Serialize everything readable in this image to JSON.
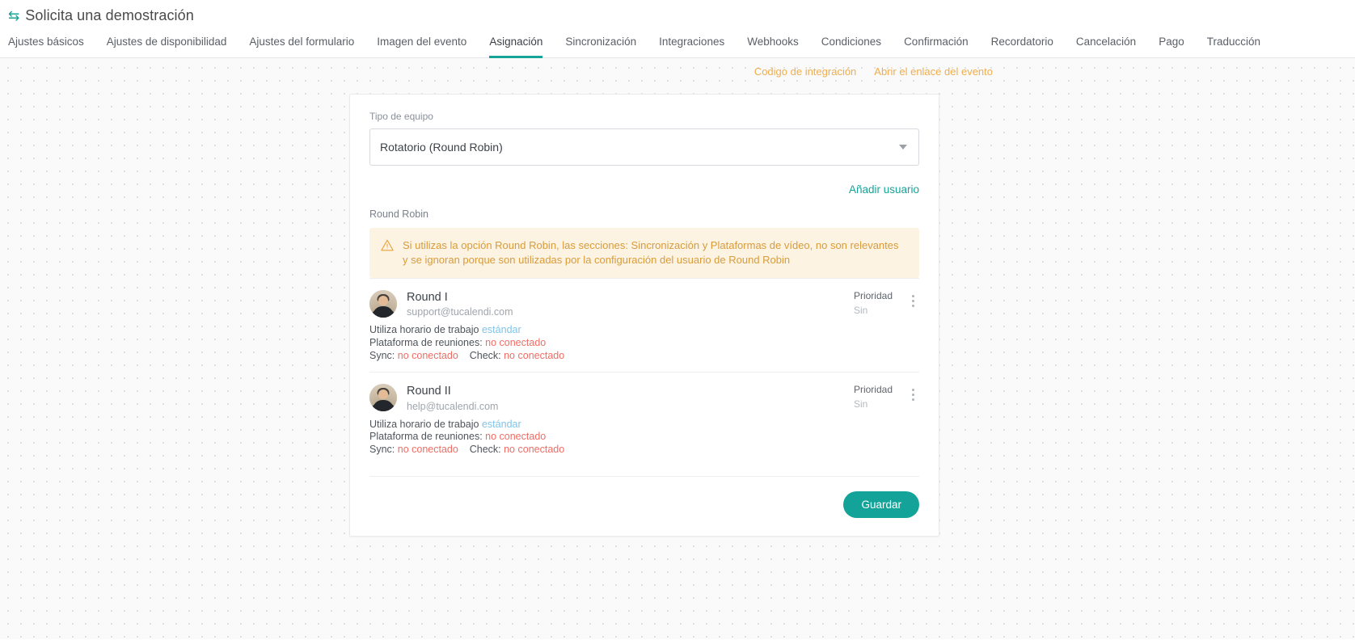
{
  "header": {
    "icon": "swap-arrows-icon",
    "title": "Solicita una demostración"
  },
  "tabs": [
    {
      "label": "Ajustes básicos",
      "active": false
    },
    {
      "label": "Ajustes de disponibilidad",
      "active": false
    },
    {
      "label": "Ajustes del formulario",
      "active": false
    },
    {
      "label": "Imagen del evento",
      "active": false
    },
    {
      "label": "Asignación",
      "active": true
    },
    {
      "label": "Sincronización",
      "active": false
    },
    {
      "label": "Integraciones",
      "active": false
    },
    {
      "label": "Webhooks",
      "active": false
    },
    {
      "label": "Condiciones",
      "active": false
    },
    {
      "label": "Confirmación",
      "active": false
    },
    {
      "label": "Recordatorio",
      "active": false
    },
    {
      "label": "Cancelación",
      "active": false
    },
    {
      "label": "Pago",
      "active": false
    },
    {
      "label": "Traducción",
      "active": false
    }
  ],
  "toplinks": [
    {
      "label": "Codigo de integración"
    },
    {
      "label": "Abrir el enlace del evento"
    }
  ],
  "form": {
    "team_type_label": "Tipo de equipo",
    "team_type_value": "Rotatorio (Round Robin)",
    "add_user_link": "Añadir usuario",
    "section_label": "Round Robin"
  },
  "warning": {
    "icon": "warning-triangle-icon",
    "text": "Si utilizas la opción Round Robin, las secciones: Sincronización y Plataformas de vídeo, no son relevantes y se ignoran porque son utilizadas por la configuración del usuario de Round Robin"
  },
  "labels": {
    "priority": "Prioridad",
    "working_hours_prefix": "Utiliza horario de trabajo",
    "meeting_platform_prefix": "Plataforma de reuniones:",
    "sync_prefix": "Sync:",
    "check_prefix": "Check:"
  },
  "users": [
    {
      "name": "Round I",
      "email": "support@tucalendi.com",
      "priority_value": "Sin",
      "working_hours": "estándar",
      "meeting_platform": "no conectado",
      "sync": "no conectado",
      "check": "no conectado"
    },
    {
      "name": "Round II",
      "email": "help@tucalendi.com",
      "priority_value": "Sin",
      "working_hours": "estándar",
      "meeting_platform": "no conectado",
      "sync": "no conectado",
      "check": "no conectado"
    }
  ],
  "footer": {
    "save_label": "Guardar"
  },
  "colors": {
    "accent_teal": "#17a398",
    "link_orange": "#f0ad4e",
    "warning_bg": "#fdf3e3",
    "warning_text": "#d89b3a",
    "status_red": "#ef6d65",
    "status_blue": "#7fc3e8"
  }
}
